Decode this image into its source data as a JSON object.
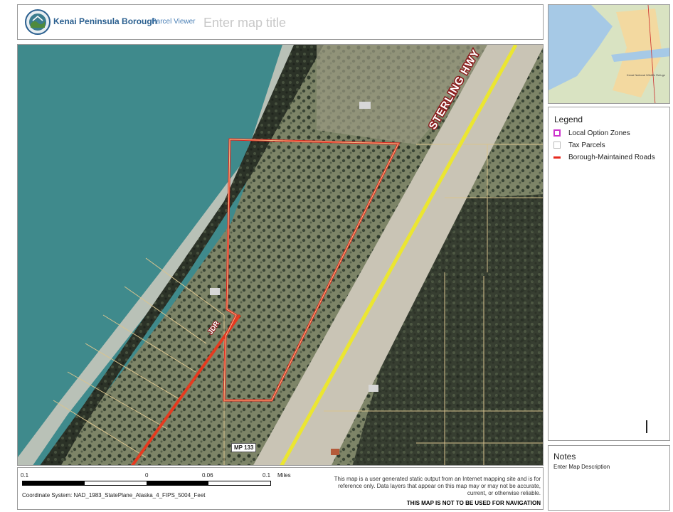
{
  "header": {
    "org_name": "Kenai Peninsula Borough",
    "app_name": "Parcel Viewer",
    "map_title_placeholder": "Enter map title"
  },
  "map": {
    "highway_label": "STERLING HWY",
    "drive_label": "JDR",
    "milepost_label": "MP 133",
    "colors": {
      "water": "#3f8a8c",
      "beach": "#b9c1b7",
      "land": "#8a8a6e",
      "parcel_outline": "#e0261e",
      "road": "#e63a1f",
      "highway": "#ebe631"
    }
  },
  "overview": {
    "labels": [
      "Kenai National Wildlife Refuge"
    ],
    "colors": {
      "water": "#a6c9e6",
      "refuge": "#f3d9a0",
      "land": "#d9e3c2"
    }
  },
  "legend": {
    "title": "Legend",
    "items": [
      {
        "label": "Local Option Zones",
        "symbol": "square-outline",
        "color": "#cc33cc"
      },
      {
        "label": "Tax Parcels",
        "symbol": "square-outline",
        "color": "#bbbbbb"
      },
      {
        "label": "Borough-Maintained Roads",
        "symbol": "line",
        "color": "#e62a1f"
      }
    ]
  },
  "notes": {
    "title": "Notes",
    "description": "Enter Map Description"
  },
  "scale": {
    "ticks": [
      "0.1",
      "0",
      "0.06",
      "0.1"
    ],
    "units": "Miles",
    "coordinate_system": "Coordinate System:   NAD_1983_StatePlane_Alaska_4_FIPS_5004_Feet"
  },
  "disclaimer": {
    "text": "This map is a user generated static output from an Internet mapping site and is for reference only. Data layers that appear on this map may or may not be accurate, current, or otherwise reliable.",
    "warning": "THIS MAP IS NOT TO BE USED FOR NAVIGATION"
  }
}
